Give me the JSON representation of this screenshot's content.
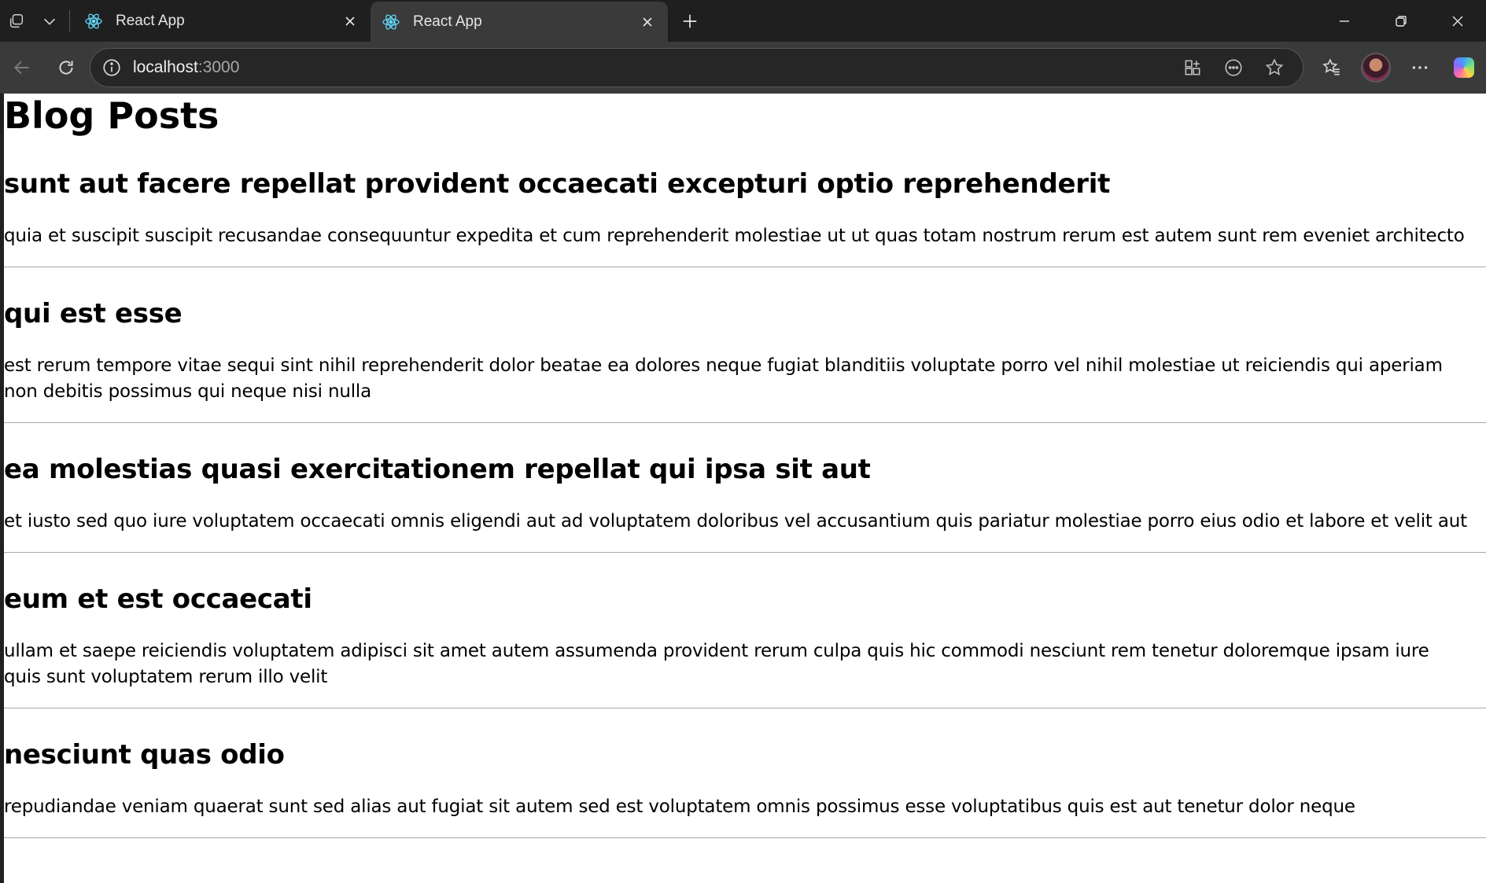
{
  "browser": {
    "tabs": [
      {
        "title": "React App",
        "active": false
      },
      {
        "title": "React App",
        "active": true
      }
    ],
    "address": {
      "host": "localhost",
      "port": ":3000"
    }
  },
  "page": {
    "title": "Blog Posts",
    "posts": [
      {
        "title": "sunt aut facere repellat provident occaecati excepturi optio reprehenderit",
        "body": "quia et suscipit suscipit recusandae consequuntur expedita et cum reprehenderit molestiae ut ut quas totam nostrum rerum est autem sunt rem eveniet architecto"
      },
      {
        "title": "qui est esse",
        "body": "est rerum tempore vitae sequi sint nihil reprehenderit dolor beatae ea dolores neque fugiat blanditiis voluptate porro vel nihil molestiae ut reiciendis qui aperiam non debitis possimus qui neque nisi nulla"
      },
      {
        "title": "ea molestias quasi exercitationem repellat qui ipsa sit aut",
        "body": "et iusto sed quo iure voluptatem occaecati omnis eligendi aut ad voluptatem doloribus vel accusantium quis pariatur molestiae porro eius odio et labore et velit aut"
      },
      {
        "title": "eum et est occaecati",
        "body": "ullam et saepe reiciendis voluptatem adipisci sit amet autem assumenda provident rerum culpa quis hic commodi nesciunt rem tenetur doloremque ipsam iure quis sunt voluptatem rerum illo velit"
      },
      {
        "title": "nesciunt quas odio",
        "body": "repudiandae veniam quaerat sunt sed alias aut fugiat sit autem sed est voluptatem omnis possimus esse voluptatibus quis est aut tenetur dolor neque"
      }
    ]
  },
  "colors": {
    "tabstrip": "#1f1f1f",
    "toolbar": "#3a3a3a",
    "react_logo": "#61dafb"
  },
  "icons": {
    "workspaces": "workspaces-icon",
    "tab_list": "chevron-down-icon",
    "favicon": "react-logo-icon",
    "close": "close-icon",
    "new_tab": "plus-icon",
    "back": "back-arrow-icon",
    "refresh": "refresh-icon",
    "site_info": "info-icon",
    "app_available": "app-install-icon",
    "reader": "more-circle-icon",
    "favorite": "star-icon",
    "favorites": "favorites-icon",
    "menu": "ellipsis-icon"
  }
}
